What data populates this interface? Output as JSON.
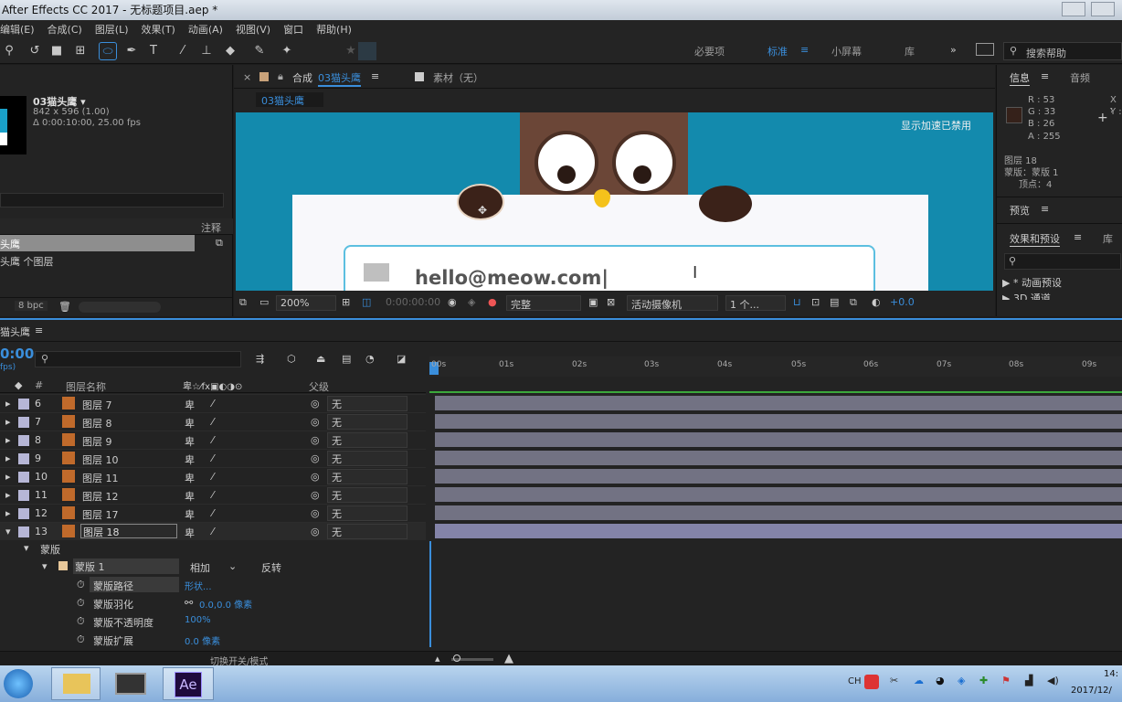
{
  "window": {
    "title": "After Effects CC 2017 - 无标题项目.aep *"
  },
  "menu": [
    "编辑(E)",
    "合成(C)",
    "图层(L)",
    "效果(T)",
    "动画(A)",
    "视图(V)",
    "窗口",
    "帮助(H)"
  ],
  "workspace": {
    "items": [
      "必要项",
      "标准",
      "小屏幕",
      "库"
    ],
    "search_placeholder": "搜索帮助"
  },
  "project": {
    "comp_name": "03猫头鹰 ▾",
    "size": "842 x 596 (1.00)",
    "duration": "Δ 0:00:10:00, 25.00 fps",
    "column": "注释",
    "item_name": "头鹰",
    "item_sub": "头鹰 个图层",
    "bpc": "8 bpc"
  },
  "comp_panel": {
    "tab_close": "×",
    "tab_label": "合成",
    "tab_comp": "03猫头鹰",
    "footage_label": "素材（无）",
    "sub_tab": "03猫头鹰",
    "accel_text": "显示加速已禁用",
    "email_text": "hello@meow.com|"
  },
  "viewer_bar": {
    "zoom": "200%",
    "timecode": "0:00:00:00",
    "quality": "完整",
    "camera": "活动摄像机",
    "views": "1 个...",
    "exposure": "+0.0"
  },
  "info": {
    "tab_info": "信息",
    "tab_audio": "音频",
    "r": "R : 53",
    "g": "G : 33",
    "b": "B : 26",
    "a": "A : 255",
    "x": "X :",
    "y": "Y :",
    "line1": "图层 18",
    "line2": "蒙版：蒙版 1",
    "line3": "顶点：4",
    "swatch": "#35211a"
  },
  "preview": {
    "label": "预览"
  },
  "effects": {
    "label": "效果和预设",
    "lib": "库",
    "item1": "▶ * 动画预设",
    "item2": "▶ 3D 通道"
  },
  "timeline": {
    "tab": "猫头鹰",
    "time": "0:00",
    "fps": "fps)",
    "col_hash": "#",
    "col_name": "图层名称",
    "col_parent": "父级",
    "ruler": [
      "00s",
      "01s",
      "02s",
      "03s",
      "04s",
      "05s",
      "06s",
      "07s",
      "08s",
      "09s"
    ],
    "layers": [
      {
        "num": "6",
        "name": "图层 7",
        "parent": "无"
      },
      {
        "num": "7",
        "name": "图层 8",
        "parent": "无"
      },
      {
        "num": "8",
        "name": "图层 9",
        "parent": "无"
      },
      {
        "num": "9",
        "name": "图层 10",
        "parent": "无"
      },
      {
        "num": "10",
        "name": "图层 11",
        "parent": "无"
      },
      {
        "num": "11",
        "name": "图层 12",
        "parent": "无"
      },
      {
        "num": "12",
        "name": "图层 17",
        "parent": "无"
      },
      {
        "num": "13",
        "name": "图层 18",
        "parent": "无"
      }
    ],
    "mask_group": "蒙版",
    "mask_name": "蒙版 1",
    "mask_mode": "相加",
    "mask_invert": "反转",
    "props": [
      {
        "name": "蒙版路径",
        "value": "形状..."
      },
      {
        "name": "蒙版羽化",
        "value": "0.0,0.0 像素"
      },
      {
        "name": "蒙版不透明度",
        "value": "100%"
      },
      {
        "name": "蒙版扩展",
        "value": "0.0 像素"
      }
    ],
    "switch_label": "切换开关/模式"
  },
  "taskbar": {
    "ae": "Ae",
    "ime": "CH",
    "clock1": "14:",
    "clock2": "2017/12/"
  }
}
